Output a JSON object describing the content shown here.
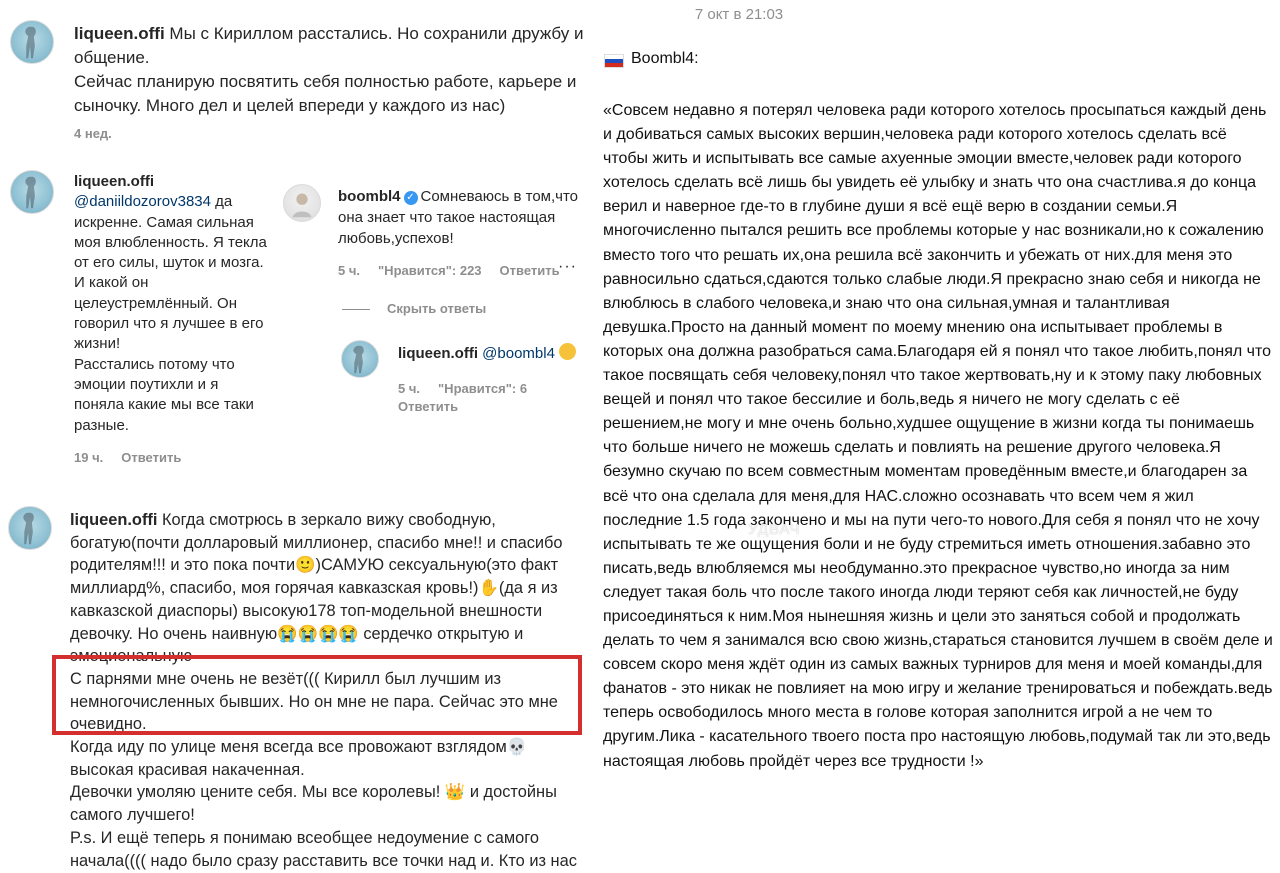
{
  "left": {
    "comment1": {
      "username": "liqueen.offi",
      "text": "Мы с Кириллом расстались. Но сохранили дружбу и общение.\nСейчас планирую посвятить себя полностью работе, карьере и сыночку. Много дел и целей впереди у каждого из нас)",
      "time": "4 нед."
    },
    "comment2": {
      "username": "liqueen.offi",
      "mention": "@daniildozorov3834",
      "text": " да искренне. Самая сильная моя влюбленность. Я текла от его силы, шуток и мозга. И какой он целеустремлённый. Он говорил что я лучшее в его жизни!\nРасстались потому что эмоции поутихли и я поняла какие мы все таки разные.",
      "time": "19 ч.",
      "reply": "Ответить"
    },
    "reply1": {
      "username": "boombl4",
      "text": "Сомневаюсь в том,что она знает что такое настоящая любовь,успехов!",
      "time": "5 ч.",
      "likes": "\"Нравится\": 223",
      "reply": "Ответить",
      "more": "···"
    },
    "hide_replies": "Скрыть ответы",
    "reply2": {
      "username": "liqueen.offi",
      "mention": "@boombl4",
      "time": "5 ч.",
      "likes": "\"Нравится\": 6",
      "reply": "Ответить"
    },
    "comment3": {
      "username": "liqueen.offi",
      "text": "Когда смотрюсь в зеркало вижу свободную, богатую(почти долларовый миллионер, спасибо мне!! и спасибо родителям!!! и это пока почти🙂)САМУЮ сексуальную(это факт миллиард%, спасибо, моя горячая кавказская кровь!)✋(да я из кавказской диаспоры) высокую178 топ-модельной внешности девочку. Но очень наивную😭😭😭😭 сердечко открытую и эмоциональную\nС парнями мне очень не везёт((( Кирилл был лучшим из немногочисленных бывших. Но он мне не пара. Сейчас это мне очевидно.\nКогда иду по улице меня всегда все провожают взглядом💀 высокая красивая накаченная.\nДевочки умоляю цените себя. Мы все королевы! 👑 и достойны самого лучшего!\nP.s. И ещё теперь я понимаю всеобщее недоумение с самого начала(((( надо было сразу расставить все точки над и. Кто из нас реально богатый! 💰А то на меня сразу накинулись, как на"
    }
  },
  "right": {
    "date": "7 окт в 21:03",
    "author": "Boombl4:",
    "watermark": "УДВАЧ",
    "post": "«Совсем недавно я потерял человека ради которого хотелось просыпаться каждый день и добиваться самых высоких вершин,человека ради которого хотелось сделать всё чтобы жить и испытывать все самые ахуенные эмоции вместе,человек ради которого хотелось сделать всё лишь бы увидеть её улыбку и знать что она счастлива.я до конца верил и наверное где-то в глубине души я всё ещё верю в создании семьи.Я многочисленно пытался решить все проблемы которые у нас возникали,но к сожалению вместо того что решать их,она решила всё закончить и убежать от них.для меня это равносильно сдаться,сдаются только слабые люди.Я прекрасно знаю себя и никогда не влюблюсь в слабого человека,и знаю что она сильная,умная и талантливая девушка.Просто на данный момент по моему мнению она испытывает проблемы в которых она должна разобраться сама.Благодаря ей я понял что такое любить,понял что такое посвящать себя человеку,понял что такое жертвовать,ну и к этому паку любовных вещей и понял что такое бессилие и боль,ведь я ничего не могу сделать с её решением,не могу и мне очень больно,худшее ощущение в жизни когда ты понимаешь что больше ничего не можешь сделать и повлиять на решение другого человека.Я безумно скучаю по всем совместным моментам проведённым вместе,и благодарен за всё что она сделала для меня,для НАС.сложно осознавать что всем чем я жил последние 1.5 года закончено и мы на пути чего-то нового.Для себя я понял что не хочу испытывать те же ощущения боли и не буду стремиться иметь отношения.забавно это писать,ведь влюбляемся мы необдуманно.это прекрасное чувство,но иногда за ним следует такая боль что после такого иногда люди теряют себя как личностей,не буду присоединяться к ним.Моя нынешняя жизнь и цели это заняться собой и продолжать делать то чем я занимался всю свою жизнь,стараться становится лучшем в своём деле и совсем скоро меня ждёт один из самых важных турниров для меня и моей команды,для фанатов - это никак не повлияет на мою игру и желание тренироваться и побеждать.ведь теперь освободилось много места в голове которая заполнится игрой а не чем то другим.Лика - касательного твоего поста про настоящую любовь,подумай так ли это,ведь настоящая любовь пройдёт через все трудности !»"
  },
  "colors": {
    "highlight_box": "#d32f2f",
    "mention": "#00376b",
    "meta": "#8e8e8e",
    "verified": "#3897f0"
  },
  "icons": [
    "avatar-photo",
    "verified-badge-icon",
    "more-options-icon",
    "russia-flag-icon",
    "sad-emoji-icon"
  ]
}
